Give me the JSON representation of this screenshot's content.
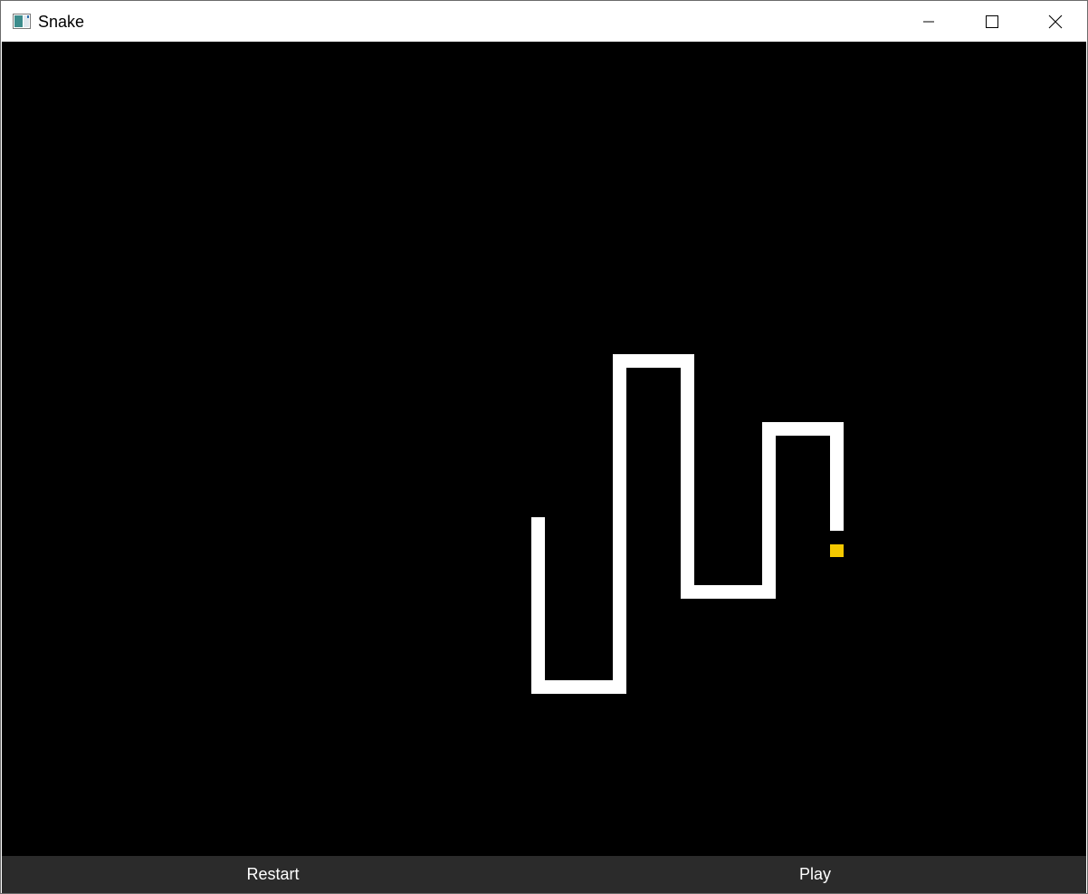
{
  "window": {
    "title": "Snake",
    "icons": {
      "app": "snake-app-icon",
      "minimize": "minimize-icon",
      "maximize": "maximize-icon",
      "close": "close-icon"
    }
  },
  "game": {
    "background_color": "#000000",
    "snake_color": "#ffffff",
    "food_color": "#f5c900"
  },
  "controls": {
    "restart_label": "Restart",
    "play_label": "Play",
    "bar_color": "#2b2b2b"
  }
}
